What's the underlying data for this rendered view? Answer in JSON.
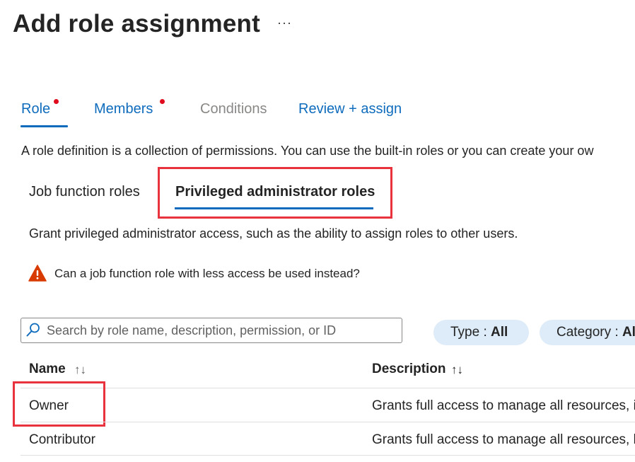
{
  "header": {
    "title": "Add role assignment",
    "more_label": "···"
  },
  "tabs": [
    {
      "label": "Role",
      "required": true,
      "active": true
    },
    {
      "label": "Members",
      "required": true,
      "active": false
    },
    {
      "label": "Conditions",
      "required": false,
      "active": false,
      "disabled": true
    },
    {
      "label": "Review + assign",
      "required": false,
      "active": false
    }
  ],
  "intro_text": "A role definition is a collection of permissions. You can use the built-in roles or you can create your ow",
  "role_tabs": [
    {
      "label": "Job function roles",
      "active": false
    },
    {
      "label": "Privileged administrator roles",
      "active": true
    }
  ],
  "description_text": "Grant privileged administrator access, such as the ability to assign roles to other users.",
  "warning": {
    "icon": "warning-icon",
    "text": "Can a job function role with less access be used instead?"
  },
  "search": {
    "placeholder": "Search by role name, description, permission, or ID",
    "value": ""
  },
  "filters": [
    {
      "label": "Type : ",
      "value": "All"
    },
    {
      "label": "Category : ",
      "value": "Al"
    }
  ],
  "table": {
    "columns": [
      {
        "label": "Name",
        "sort_icon": "↑↓"
      },
      {
        "label": "Description",
        "sort_icon": "↑↓"
      }
    ],
    "rows": [
      {
        "name": "Owner",
        "description": "Grants full access to manage all resources, i"
      },
      {
        "name": "Contributor",
        "description": "Grants full access to manage all resources, b"
      }
    ]
  },
  "colors": {
    "accent": "#0f6cbd",
    "required_dot": "#e00b1c",
    "highlight": "#e8333f",
    "pill_bg": "#deecf9",
    "warning": "#d83b01"
  }
}
